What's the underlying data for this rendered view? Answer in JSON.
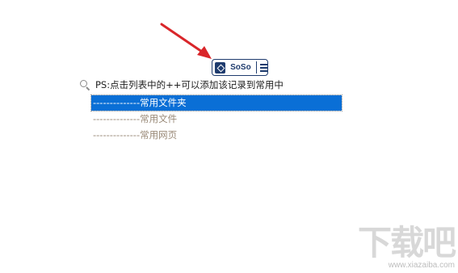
{
  "toolbar": {
    "app_name": "SoSo",
    "logo_icon": "folder-search-icon",
    "menu_icon": "hamburger-menu-icon"
  },
  "annotation": {
    "arrow_icon": "red-arrow-icon",
    "color": "#d9262a"
  },
  "hint": {
    "icon": "search-icon",
    "text": "PS:点击列表中的++可以添加该记录到常用中"
  },
  "list": {
    "items": [
      {
        "label": "--------------常用文件夹",
        "selected": true
      },
      {
        "label": "--------------常用文件",
        "selected": false
      },
      {
        "label": "--------------常用网页",
        "selected": false
      }
    ]
  },
  "colors": {
    "selection": "#0a6fd6",
    "item_text": "#9a8a78",
    "brand": "#1f3c6e"
  },
  "watermark": {
    "big": "下载吧",
    "small": "www.xiazaiba.com"
  }
}
